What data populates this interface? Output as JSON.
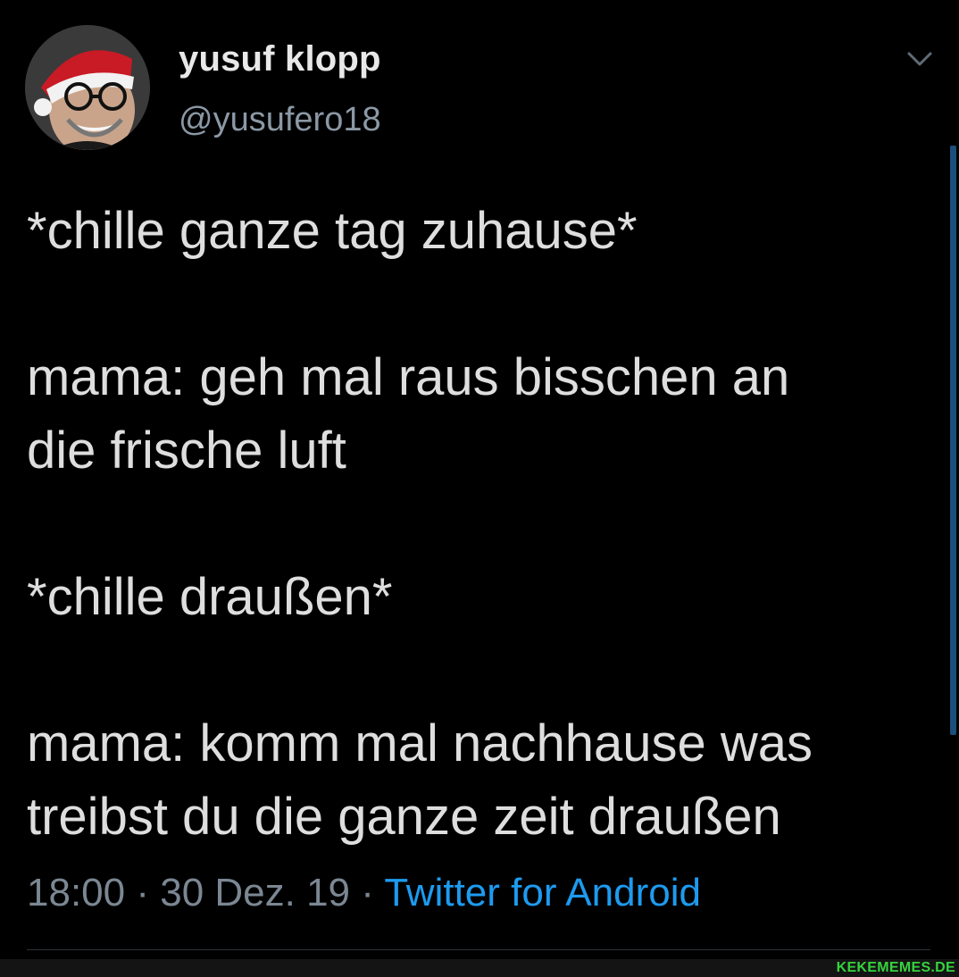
{
  "author": {
    "display_name": "yusuf klopp",
    "handle": "@yusufero18"
  },
  "tweet": {
    "paragraphs": [
      "*chille ganze tag zuhause*",
      "mama: geh mal raus bisschen an\ndie frische luft",
      "*chille draußen*",
      "mama: komm mal nachhause was\ntreibst du die ganze zeit draußen"
    ],
    "time": "18:00",
    "separator": " · ",
    "date": "30 Dez. 19",
    "source": "Twitter for Android"
  },
  "icons": {
    "more_menu": "chevron-down-icon"
  },
  "colors": {
    "background": "#000000",
    "text": "#dedede",
    "muted": "#7b8792",
    "accent": "#1d9bf0",
    "watermark": "#35d43d"
  },
  "watermark": "KEKEMEMES.DE"
}
